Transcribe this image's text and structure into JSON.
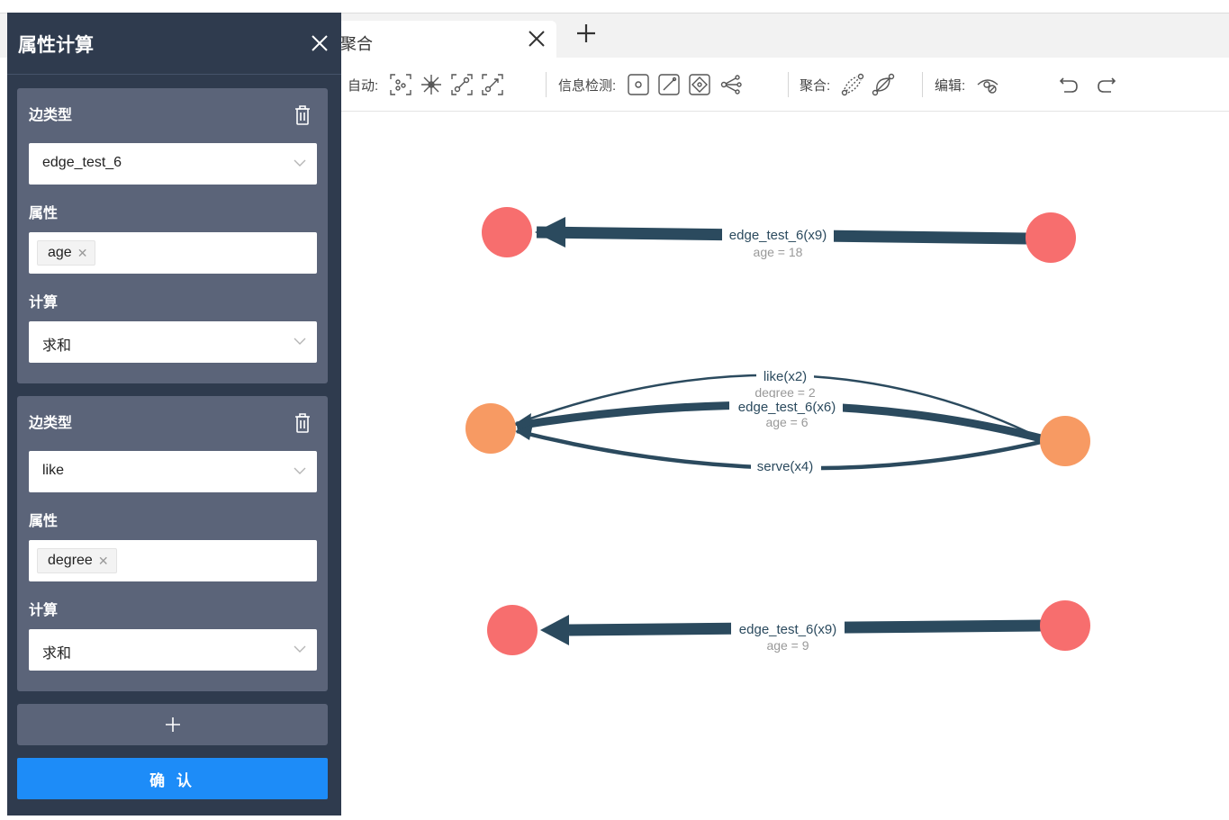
{
  "tab": {
    "title": "聚合"
  },
  "toolbar": {
    "auto_label": "自动:",
    "info_label": "信息检测:",
    "aggregate_label": "聚合:",
    "edit_label": "编辑:"
  },
  "panel": {
    "title": "属性计算",
    "cards": [
      {
        "edge_type_label": "边类型",
        "edge_type_value": "edge_test_6",
        "property_label": "属性",
        "property_tags": [
          "age"
        ],
        "calc_label": "计算",
        "calc_value": "求和"
      },
      {
        "edge_type_label": "边类型",
        "edge_type_value": "like",
        "property_label": "属性",
        "property_tags": [
          "degree"
        ],
        "calc_label": "计算",
        "calc_value": "求和"
      }
    ],
    "add_label": "+",
    "confirm_label": "确 认"
  },
  "graph": {
    "colors": {
      "red_node": "#f76e6e",
      "orange_node": "#f79a63",
      "edge": "#2b4a5e",
      "edge_sub": "#999999"
    },
    "edges": [
      {
        "label": "edge_test_6(x9)",
        "sub": "age = 18"
      },
      {
        "label": "like(x2)",
        "sub": "degree = 2"
      },
      {
        "label": "edge_test_6(x6)",
        "sub": "age = 6"
      },
      {
        "label": "serve(x4)",
        "sub": ""
      },
      {
        "label": "edge_test_6(x9)",
        "sub": "age = 9"
      }
    ]
  }
}
